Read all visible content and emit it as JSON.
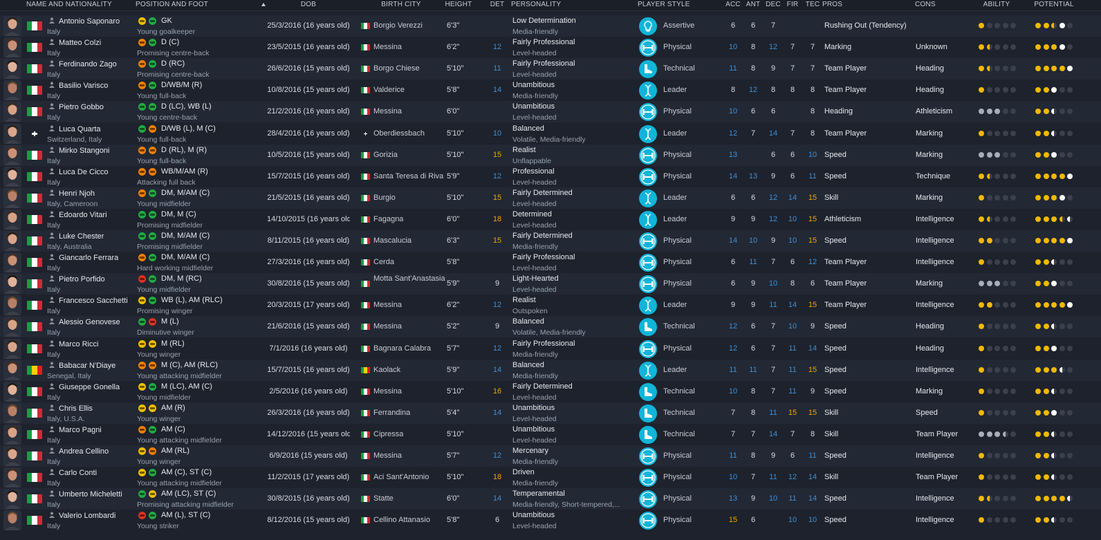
{
  "headers": {
    "name": "NAME AND NATIONALITY",
    "position": "POSITION AND FOOT",
    "dob": "DOB",
    "city": "BIRTH CITY",
    "height": "HEIGHT",
    "det": "DET",
    "personality": "PERSONALITY",
    "style": "PLAYER STYLE",
    "acc": "ACC",
    "ant": "ANT",
    "dec": "DEC",
    "fir": "FIR",
    "tec": "TEC",
    "pros": "PROS",
    "cons": "CONS",
    "ability": "ABILITY",
    "potential": "POTENTIAL"
  },
  "colors": {
    "stat_white": "#d8dce4",
    "stat_blue": "#3f8fd6",
    "stat_yellow": "#f0a800",
    "star": "#f5b800",
    "style_icon": "#10b5d9"
  },
  "players": [
    {
      "name": "Antonio Saponaro",
      "nat": "Italy",
      "flag": "it",
      "pos": "GK",
      "role": "Young goalkeeper",
      "foot": [
        "#f0c000",
        "#22aa44"
      ],
      "dob": "25/3/2016 (16 years old)",
      "city": "Borgio Verezzi",
      "cityflag": "it",
      "height": "6'3\"",
      "det": "",
      "p1": "Low Determination",
      "p2": "Media-friendly",
      "style": "Assertive",
      "icon": "bulb-icon",
      "acc": "6",
      "ant": "6",
      "dec": "7",
      "fir": "",
      "tec": "",
      "pros": "Rushing Out (Tendency)",
      "cons": "",
      "ability": "f,e,e,e,e",
      "potential": "f,f,h,w,e"
    },
    {
      "name": "Matteo Colzi",
      "nat": "Italy",
      "flag": "it",
      "pos": "D (C)",
      "role": "Promising centre-back",
      "foot": [
        "#f08000",
        "#22aa44"
      ],
      "dob": "23/5/2015 (16 years old)",
      "city": "Messina",
      "cityflag": "it",
      "height": "6'2\"",
      "det": "12",
      "p1": "Fairly Professional",
      "p2": "Level-headed",
      "style": "Physical",
      "icon": "dumbbell-icon",
      "acc": "10",
      "ant": "8",
      "dec": "12",
      "fir": "7",
      "tec": "7",
      "pros": "Marking",
      "cons": "Unknown",
      "ability": "f,h,e,e,e",
      "potential": "f,f,f,w,e"
    },
    {
      "name": "Ferdinando Zago",
      "nat": "Italy",
      "flag": "it",
      "pos": "D (RC)",
      "role": "Promising centre-back",
      "foot": [
        "#f08000",
        "#22aa44"
      ],
      "dob": "26/6/2016 (15 years old)",
      "city": "Borgo Chiese",
      "cityflag": "it",
      "height": "5'10\"",
      "det": "11",
      "p1": "Fairly Professional",
      "p2": "Level-headed",
      "style": "Technical",
      "icon": "boot-icon",
      "acc": "11",
      "ant": "8",
      "dec": "9",
      "fir": "7",
      "tec": "7",
      "pros": "Team Player",
      "cons": "Heading",
      "ability": "f,h,e,e,e",
      "potential": "f,f,f,f,w"
    },
    {
      "name": "Basilio Varisco",
      "nat": "Italy",
      "flag": "it",
      "pos": "D/WB/M (R)",
      "role": "Young full-back",
      "foot": [
        "#f08000",
        "#22aa44"
      ],
      "dob": "10/8/2016 (15 years old)",
      "city": "Valderice",
      "cityflag": "it",
      "height": "5'8\"",
      "det": "14",
      "p1": "Unambitious",
      "p2": "Media-friendly",
      "style": "Leader",
      "icon": "dna-icon",
      "acc": "8",
      "ant": "12",
      "dec": "8",
      "fir": "8",
      "tec": "8",
      "pros": "Team Player",
      "cons": "Heading",
      "ability": "f,e,e,e,e",
      "potential": "f,f,w,e,e"
    },
    {
      "name": "Pietro Gobbo",
      "nat": "Italy",
      "flag": "it",
      "pos": "D (LC), WB (L)",
      "role": "Young centre-back",
      "foot": [
        "#22aa44",
        "#22aa44"
      ],
      "dob": "21/2/2016 (16 years old)",
      "city": "Messina",
      "cityflag": "it",
      "height": "6'0\"",
      "det": "",
      "p1": "Unambitious",
      "p2": "Level-headed",
      "style": "Physical",
      "icon": "dumbbell-icon",
      "acc": "10",
      "ant": "6",
      "dec": "6",
      "fir": "",
      "tec": "8",
      "pros": "Heading",
      "cons": "Athleticism",
      "ability": "g,g,g,e,e",
      "potential": "f,f,wh,e,e"
    },
    {
      "name": "Luca Quarta",
      "nat": "Switzerland, Italy",
      "flag": "ch",
      "pos": "D/WB (L), M (C)",
      "role": "Young full-back",
      "foot": [
        "#22aa44",
        "#f08000"
      ],
      "dob": "28/4/2016 (16 years old)",
      "city": "Oberdiessbach",
      "cityflag": "ch",
      "height": "5'10\"",
      "det": "10",
      "p1": "Balanced",
      "p2": "Volatile, Media-friendly",
      "style": "Leader",
      "icon": "dna-icon",
      "acc": "12",
      "ant": "7",
      "dec": "14",
      "fir": "7",
      "tec": "8",
      "pros": "Team Player",
      "cons": "Marking",
      "ability": "f,e,e,e,e",
      "potential": "f,f,wh,e,e"
    },
    {
      "name": "Mirko Stangoni",
      "nat": "Italy",
      "flag": "it",
      "pos": "D (RL), M (R)",
      "role": "Young full-back",
      "foot": [
        "#f08000",
        "#f08000"
      ],
      "dob": "10/5/2016 (15 years old)",
      "city": "Gorizia",
      "cityflag": "it",
      "height": "5'10\"",
      "det": "15",
      "p1": "Realist",
      "p2": "Unflappable",
      "style": "Physical",
      "icon": "dumbbell-icon",
      "acc": "13",
      "ant": "",
      "dec": "6",
      "fir": "6",
      "tec": "10",
      "pros": "Speed",
      "cons": "Marking",
      "ability": "g,g,g,e,e",
      "potential": "f,f,w,e,e"
    },
    {
      "name": "Luca De Cicco",
      "nat": "Italy",
      "flag": "it",
      "pos": "WB/M/AM (R)",
      "role": "Attacking full back",
      "foot": [
        "#f08000",
        "#f08000"
      ],
      "dob": "15/7/2015 (16 years old)",
      "city": "Santa Teresa di Riva",
      "cityflag": "it",
      "height": "5'9\"",
      "det": "12",
      "p1": "Professional",
      "p2": "Level-headed",
      "style": "Physical",
      "icon": "dumbbell-icon",
      "acc": "14",
      "ant": "13",
      "dec": "9",
      "fir": "6",
      "tec": "11",
      "pros": "Speed",
      "cons": "Technique",
      "ability": "f,h,e,e,e",
      "potential": "f,f,f,f,w"
    },
    {
      "name": "Henri Njoh",
      "nat": "Italy, Cameroon",
      "flag": "it",
      "pos": "DM, M/AM (C)",
      "role": "Young midfielder",
      "foot": [
        "#f08000",
        "#22aa44"
      ],
      "dob": "21/5/2015 (16 years old)",
      "city": "Burgio",
      "cityflag": "it",
      "height": "5'10\"",
      "det": "15",
      "p1": "Fairly Determined",
      "p2": "Level-headed",
      "style": "Leader",
      "icon": "dna-icon",
      "acc": "6",
      "ant": "6",
      "dec": "12",
      "fir": "14",
      "tec": "15",
      "pros": "Skill",
      "cons": "Marking",
      "ability": "f,e,e,e,e",
      "potential": "f,f,f,w,e"
    },
    {
      "name": "Edoardo Vitari",
      "nat": "Italy",
      "flag": "it",
      "pos": "DM, M (C)",
      "role": "Promising midfielder",
      "foot": [
        "#22aa44",
        "#22aa44"
      ],
      "dob": "14/10/2015 (16 years old)",
      "city": "Fagagna",
      "cityflag": "it",
      "height": "6'0\"",
      "det": "18",
      "p1": "Determined",
      "p2": "Level-headed",
      "style": "Leader",
      "icon": "dna-icon",
      "acc": "9",
      "ant": "9",
      "dec": "12",
      "fir": "10",
      "tec": "15",
      "pros": "Athleticism",
      "cons": "Intelligence",
      "ability": "f,h,e,e,e",
      "potential": "f,f,f,h,wh"
    },
    {
      "name": "Luke Chester",
      "nat": "Italy, Australia",
      "flag": "it",
      "pos": "DM, M/AM (C)",
      "role": "Promising midfielder",
      "foot": [
        "#22aa44",
        "#22aa44"
      ],
      "dob": "8/11/2015 (16 years old)",
      "city": "Mascalucia",
      "cityflag": "it",
      "height": "6'3\"",
      "det": "15",
      "p1": "Fairly Determined",
      "p2": "Media-friendly",
      "style": "Physical",
      "icon": "dumbbell-icon",
      "acc": "14",
      "ant": "10",
      "dec": "9",
      "fir": "10",
      "tec": "15",
      "pros": "Speed",
      "cons": "Intelligence",
      "ability": "f,f,e,e,e",
      "potential": "f,f,f,f,w"
    },
    {
      "name": "Giancarlo Ferrara",
      "nat": "Italy",
      "flag": "it",
      "pos": "DM, M/AM (C)",
      "role": "Hard working midfielder",
      "foot": [
        "#f08000",
        "#22aa44"
      ],
      "dob": "27/3/2016 (16 years old)",
      "city": "Cerda",
      "cityflag": "it",
      "height": "5'8\"",
      "det": "",
      "p1": "Fairly Professional",
      "p2": "Level-headed",
      "style": "Physical",
      "icon": "dumbbell-icon",
      "acc": "6",
      "ant": "11",
      "dec": "7",
      "fir": "6",
      "tec": "12",
      "pros": "Team Player",
      "cons": "Intelligence",
      "ability": "f,e,e,e,e",
      "potential": "f,f,wh,e,e"
    },
    {
      "name": "Pietro Porfido",
      "nat": "Italy",
      "flag": "it",
      "pos": "DM, M (RC)",
      "role": "Young midfielder",
      "foot": [
        "#dd3322",
        "#22aa44"
      ],
      "dob": "30/8/2016 (15 years old)",
      "city": "Motta Sant'Anastasia",
      "cityflag": "it",
      "height": "5'9\"",
      "det": "9",
      "p1": "Light-Hearted",
      "p2": "Level-headed",
      "style": "Physical",
      "icon": "dumbbell-icon",
      "acc": "6",
      "ant": "9",
      "dec": "10",
      "fir": "8",
      "tec": "6",
      "pros": "Team Player",
      "cons": "Marking",
      "ability": "g,g,g,e,e",
      "potential": "f,f,w,e,e"
    },
    {
      "name": "Francesco Sacchetti",
      "nat": "Italy",
      "flag": "it",
      "pos": "WB (L), AM (RLC)",
      "role": "Promising winger",
      "foot": [
        "#f0c000",
        "#22aa44"
      ],
      "dob": "20/3/2015 (17 years old)",
      "city": "Messina",
      "cityflag": "it",
      "height": "6'2\"",
      "det": "12",
      "p1": "Realist",
      "p2": "Outspoken",
      "style": "Leader",
      "icon": "dna-icon",
      "acc": "9",
      "ant": "9",
      "dec": "11",
      "fir": "14",
      "tec": "15",
      "pros": "Team Player",
      "cons": "Intelligence",
      "ability": "f,f,e,e,e",
      "potential": "f,f,f,f,w"
    },
    {
      "name": "Alessio Genovese",
      "nat": "Italy",
      "flag": "it",
      "pos": "M (L)",
      "role": "Diminutive winger",
      "foot": [
        "#22aa44",
        "#dd3322"
      ],
      "dob": "21/6/2016 (15 years old)",
      "city": "Messina",
      "cityflag": "it",
      "height": "5'2\"",
      "det": "9",
      "p1": "Balanced",
      "p2": "Volatile, Media-friendly",
      "style": "Technical",
      "icon": "boot-icon",
      "acc": "12",
      "ant": "6",
      "dec": "7",
      "fir": "10",
      "tec": "9",
      "pros": "Speed",
      "cons": "Heading",
      "ability": "f,e,e,e,e",
      "potential": "f,f,wh,e,e"
    },
    {
      "name": "Marco Ricci",
      "nat": "Italy",
      "flag": "it",
      "pos": "M (RL)",
      "role": "Young winger",
      "foot": [
        "#f0c000",
        "#f0c000"
      ],
      "dob": "7/1/2016 (16 years old)",
      "city": "Bagnara Calabra",
      "cityflag": "it",
      "height": "5'7\"",
      "det": "12",
      "p1": "Fairly Professional",
      "p2": "Media-friendly",
      "style": "Physical",
      "icon": "dumbbell-icon",
      "acc": "12",
      "ant": "6",
      "dec": "7",
      "fir": "11",
      "tec": "14",
      "pros": "Speed",
      "cons": "Heading",
      "ability": "f,e,e,e,e",
      "potential": "f,f,w,e,e"
    },
    {
      "name": "Babacar N'Diaye",
      "nat": "Senegal, Italy",
      "flag": "sn",
      "pos": "M (C), AM (RLC)",
      "role": "Young attacking midfielder",
      "foot": [
        "#f08000",
        "#f08000"
      ],
      "dob": "15/7/2015 (16 years old)",
      "city": "Kaolack",
      "cityflag": "sn",
      "height": "5'9\"",
      "det": "14",
      "p1": "Balanced",
      "p2": "Media-friendly",
      "style": "Leader",
      "icon": "dna-icon",
      "acc": "11",
      "ant": "11",
      "dec": "7",
      "fir": "11",
      "tec": "15",
      "pros": "Speed",
      "cons": "Intelligence",
      "ability": "f,e,e,e,e",
      "potential": "f,f,f,wh,e"
    },
    {
      "name": "Giuseppe Gonella",
      "nat": "Italy",
      "flag": "it",
      "pos": "M (LC), AM (C)",
      "role": "Young midfielder",
      "foot": [
        "#f0c000",
        "#22aa44"
      ],
      "dob": "2/5/2016 (16 years old)",
      "city": "Messina",
      "cityflag": "it",
      "height": "5'10\"",
      "det": "16",
      "p1": "Fairly Determined",
      "p2": "Level-headed",
      "style": "Technical",
      "icon": "boot-icon",
      "acc": "10",
      "ant": "8",
      "dec": "7",
      "fir": "11",
      "tec": "9",
      "pros": "Speed",
      "cons": "Marking",
      "ability": "f,e,e,e,e",
      "potential": "f,f,wh,e,e"
    },
    {
      "name": "Chris Ellis",
      "nat": "Italy, U.S.A.",
      "flag": "it",
      "pos": "AM (R)",
      "role": "Young winger",
      "foot": [
        "#f0c000",
        "#f0c000"
      ],
      "dob": "26/3/2016 (16 years old)",
      "city": "Ferrandina",
      "cityflag": "it",
      "height": "5'4\"",
      "det": "14",
      "p1": "Unambitious",
      "p2": "Level-headed",
      "style": "Technical",
      "icon": "boot-icon",
      "acc": "7",
      "ant": "8",
      "dec": "11",
      "fir": "15",
      "tec": "15",
      "pros": "Skill",
      "cons": "Speed",
      "ability": "f,e,e,e,e",
      "potential": "f,f,w,e,e"
    },
    {
      "name": "Marco Pagni",
      "nat": "Italy",
      "flag": "it",
      "pos": "AM (C)",
      "role": "Young attacking midfielder",
      "foot": [
        "#f08000",
        "#22aa44"
      ],
      "dob": "14/12/2016 (15 years old)",
      "city": "Cipressa",
      "cityflag": "it",
      "height": "5'10\"",
      "det": "",
      "p1": "Unambitious",
      "p2": "Level-headed",
      "style": "Technical",
      "icon": "boot-icon",
      "acc": "7",
      "ant": "7",
      "dec": "14",
      "fir": "7",
      "tec": "8",
      "pros": "Skill",
      "cons": "Team Player",
      "ability": "g,g,g,gh,e",
      "potential": "f,f,wh,e,e"
    },
    {
      "name": "Andrea Cellino",
      "nat": "Italy",
      "flag": "it",
      "pos": "AM (RL)",
      "role": "Young winger",
      "foot": [
        "#f0c000",
        "#f08000"
      ],
      "dob": "6/9/2016 (15 years old)",
      "city": "Messina",
      "cityflag": "it",
      "height": "5'7\"",
      "det": "12",
      "p1": "Mercenary",
      "p2": "Media-friendly",
      "style": "Physical",
      "icon": "dumbbell-icon",
      "acc": "11",
      "ant": "8",
      "dec": "9",
      "fir": "6",
      "tec": "11",
      "pros": "Speed",
      "cons": "Intelligence",
      "ability": "f,e,e,e,e",
      "potential": "f,f,wh,e,e"
    },
    {
      "name": "Carlo Conti",
      "nat": "Italy",
      "flag": "it",
      "pos": "AM (C), ST (C)",
      "role": "Young attacking midfielder",
      "foot": [
        "#f0c000",
        "#22aa44"
      ],
      "dob": "11/2/2015 (17 years old)",
      "city": "Aci Sant'Antonio",
      "cityflag": "it",
      "height": "5'10\"",
      "det": "18",
      "p1": "Driven",
      "p2": "Media-friendly",
      "style": "Physical",
      "icon": "dumbbell-icon",
      "acc": "10",
      "ant": "7",
      "dec": "11",
      "fir": "12",
      "tec": "14",
      "pros": "Skill",
      "cons": "Team Player",
      "ability": "f,e,e,e,e",
      "potential": "f,f,wh,e,e"
    },
    {
      "name": "Umberto Micheletti",
      "nat": "Italy",
      "flag": "it",
      "pos": "AM (LC), ST (C)",
      "role": "Promising attacking midfielder",
      "foot": [
        "#22aa44",
        "#f0c000"
      ],
      "dob": "30/8/2015 (16 years old)",
      "city": "Statte",
      "cityflag": "it",
      "height": "6'0\"",
      "det": "14",
      "p1": "Temperamental",
      "p2": "Media-friendly, Short-tempered,...",
      "style": "Physical",
      "icon": "dumbbell-icon",
      "acc": "13",
      "ant": "9",
      "dec": "10",
      "fir": "11",
      "tec": "14",
      "pros": "Speed",
      "cons": "Intelligence",
      "ability": "f,h,e,e,e",
      "potential": "f,f,f,f,wh"
    },
    {
      "name": "Valerio Lombardi",
      "nat": "Italy",
      "flag": "it",
      "pos": "AM (L), ST (C)",
      "role": "Young striker",
      "foot": [
        "#dd3322",
        "#22aa44"
      ],
      "dob": "8/12/2016 (15 years old)",
      "city": "Cellino Attanasio",
      "cityflag": "it",
      "height": "5'8\"",
      "det": "6",
      "p1": "Unambitious",
      "p2": "Level-headed",
      "style": "Physical",
      "icon": "dumbbell-icon",
      "acc": "15",
      "ant": "6",
      "dec": "",
      "fir": "10",
      "tec": "10",
      "pros": "Speed",
      "cons": "Intelligence",
      "ability": "f,e,e,e,e",
      "potential": "f,f,wh,e,e"
    }
  ]
}
